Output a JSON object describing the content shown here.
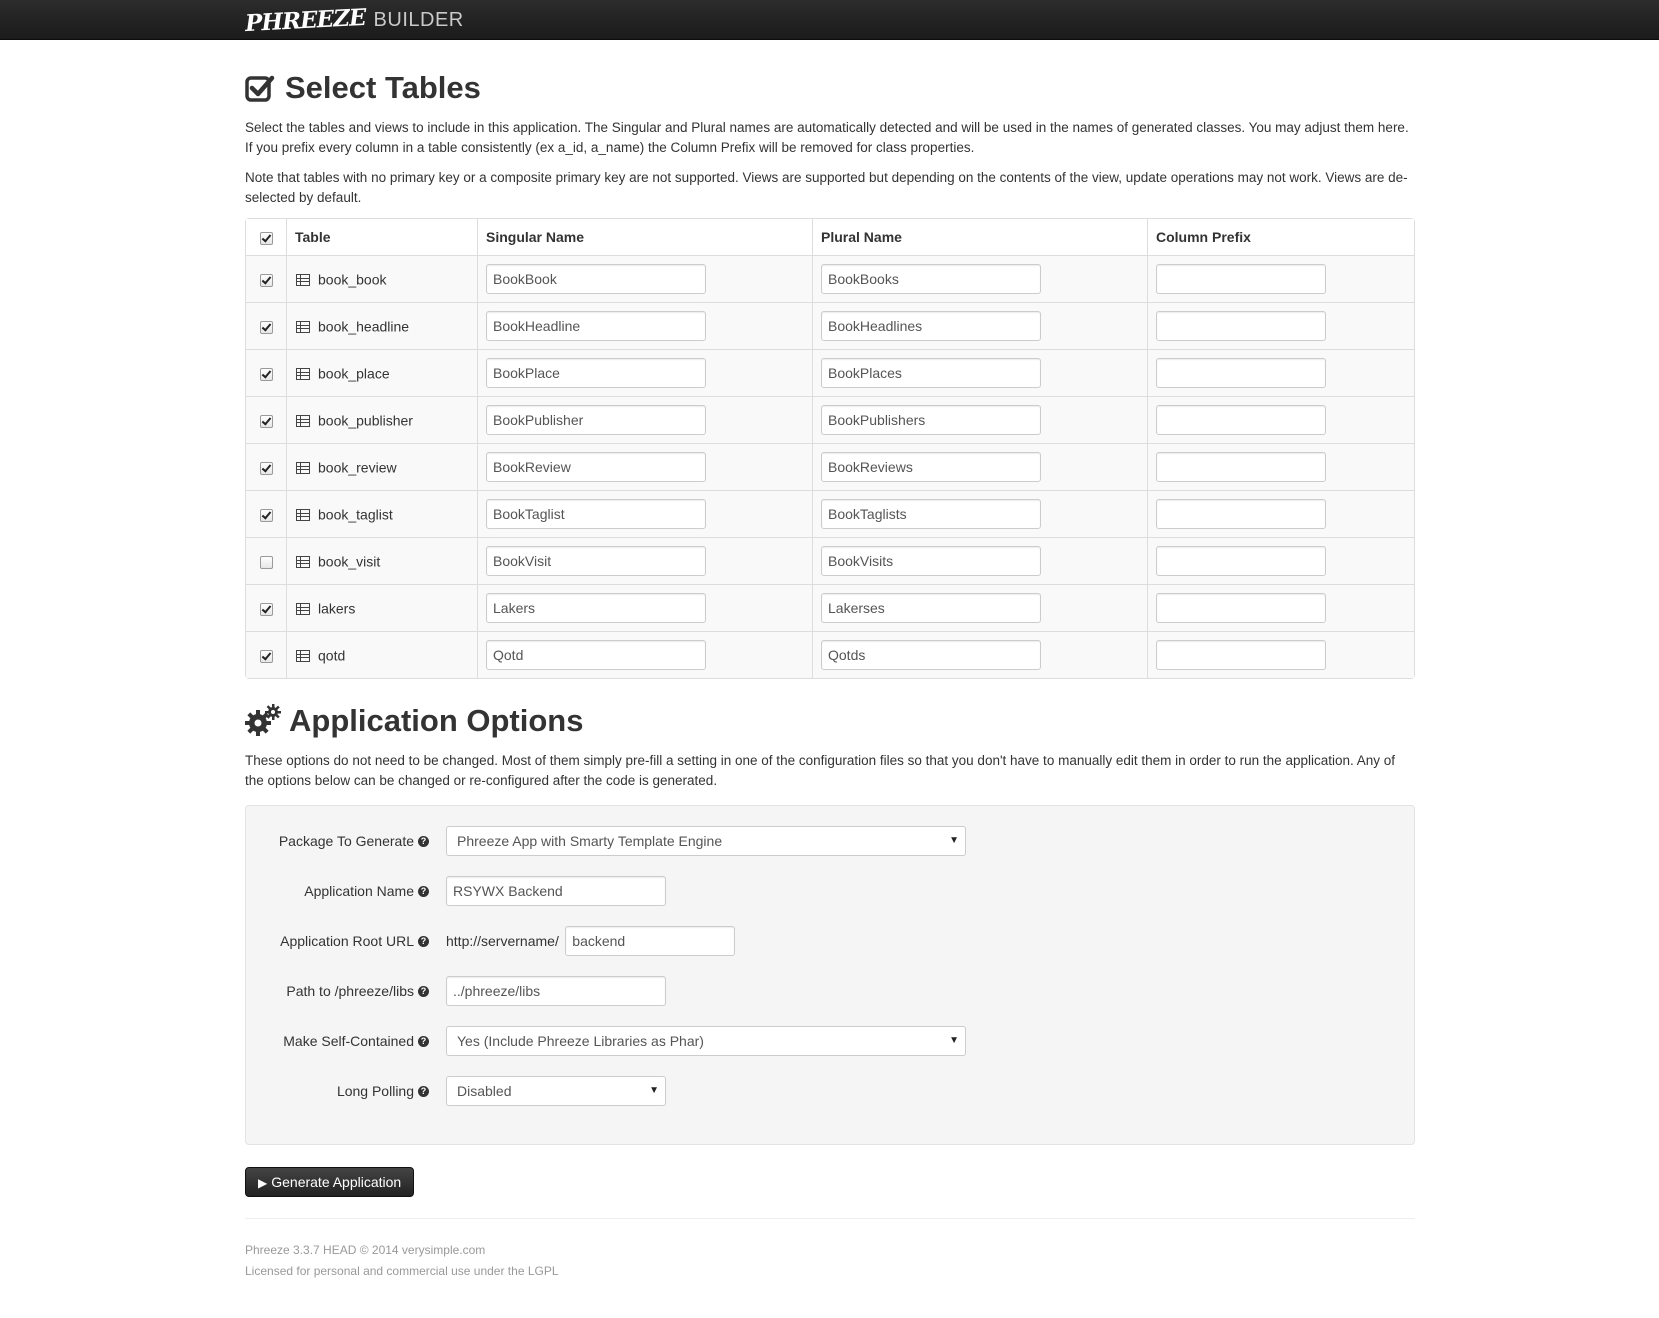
{
  "navbar": {
    "brand_logo": "PHREEZE",
    "brand_text": "BUILDER"
  },
  "select_tables": {
    "title": "Select Tables",
    "intro": "Select the tables and views to include in this application. The Singular and Plural names are automatically detected and will be used in the names of generated classes. You may adjust them here. If you prefix every column in a table consistently (ex a_id, a_name) the Column Prefix will be removed for class properties.",
    "note": "Note that tables with no primary key or a composite primary key are not supported. Views are supported but depending on the contents of the view, update operations may not work. Views are de-selected by default.",
    "select_all_checked": true,
    "columns": [
      "Table",
      "Singular Name",
      "Plural Name",
      "Column Prefix"
    ],
    "rows": [
      {
        "checked": true,
        "table": "book_book",
        "singular": "BookBook",
        "plural": "BookBooks",
        "prefix": ""
      },
      {
        "checked": true,
        "table": "book_headline",
        "singular": "BookHeadline",
        "plural": "BookHeadlines",
        "prefix": ""
      },
      {
        "checked": true,
        "table": "book_place",
        "singular": "BookPlace",
        "plural": "BookPlaces",
        "prefix": ""
      },
      {
        "checked": true,
        "table": "book_publisher",
        "singular": "BookPublisher",
        "plural": "BookPublishers",
        "prefix": ""
      },
      {
        "checked": true,
        "table": "book_review",
        "singular": "BookReview",
        "plural": "BookReviews",
        "prefix": ""
      },
      {
        "checked": true,
        "table": "book_taglist",
        "singular": "BookTaglist",
        "plural": "BookTaglists",
        "prefix": ""
      },
      {
        "checked": false,
        "table": "book_visit",
        "singular": "BookVisit",
        "plural": "BookVisits",
        "prefix": ""
      },
      {
        "checked": true,
        "table": "lakers",
        "singular": "Lakers",
        "plural": "Lakerses",
        "prefix": ""
      },
      {
        "checked": true,
        "table": "qotd",
        "singular": "Qotd",
        "plural": "Qotds",
        "prefix": ""
      }
    ]
  },
  "app_options": {
    "title": "Application Options",
    "intro": "These options do not need to be changed. Most of them simply pre-fill a setting in one of the configuration files so that you don't have to manually edit them in order to run the application. Any of the options below can be changed or re-configured after the code is generated.",
    "package_label": "Package To Generate",
    "package_value": "Phreeze App with Smarty Template Engine",
    "app_name_label": "Application Name",
    "app_name_value": "RSYWX Backend",
    "root_url_label": "Application Root URL",
    "root_url_prefix": "http://servername/",
    "root_url_value": "backend",
    "libs_label": "Path to /phreeze/libs",
    "libs_value": "../phreeze/libs",
    "self_contained_label": "Make Self-Contained",
    "self_contained_value": "Yes (Include Phreeze Libraries as Phar)",
    "long_polling_label": "Long Polling",
    "long_polling_value": "Disabled",
    "help_glyph": "?"
  },
  "generate_button": {
    "label": "Generate Application",
    "icon": "play-icon"
  },
  "footer": {
    "line1": "Phreeze 3.3.7 HEAD © 2014 verysimple.com",
    "line2": "Licensed for personal and commercial use under the LGPL"
  },
  "colors": {
    "navbar": "#1b1b1b",
    "well": "#f5f5f5",
    "button": "#333333",
    "border": "#dddddd"
  }
}
